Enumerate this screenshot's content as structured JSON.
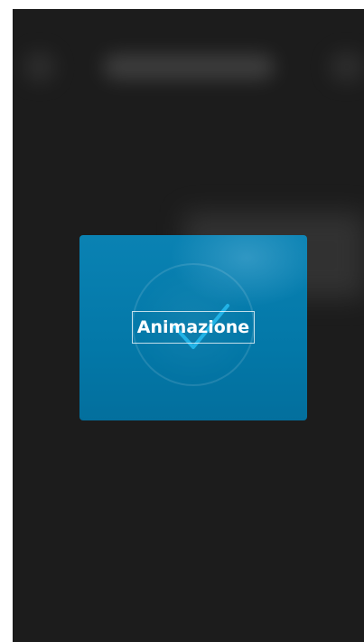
{
  "dialog": {
    "title": "Animazione"
  },
  "icons": {
    "success": "checkmark-icon"
  },
  "colors": {
    "background": "#1c1c1c",
    "card": "#0378a8",
    "check": "#22b3e6"
  }
}
